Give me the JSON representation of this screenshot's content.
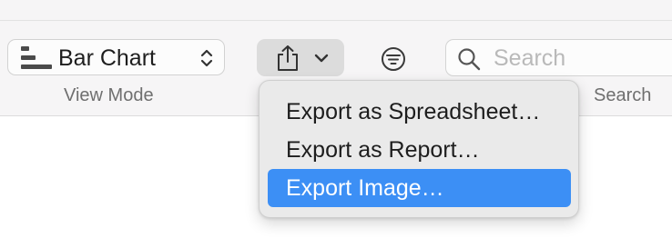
{
  "toolbar": {
    "view_mode": {
      "selected": "Bar Chart",
      "caption": "View Mode"
    },
    "export_button": {
      "icon": "share-icon"
    },
    "filter_button": {
      "icon": "filter-icon"
    },
    "search": {
      "placeholder": "Search",
      "caption": "Search"
    }
  },
  "export_menu": {
    "items": [
      {
        "label": "Export as Spreadsheet…",
        "selected": false
      },
      {
        "label": "Export as Report…",
        "selected": false
      },
      {
        "label": "Export Image…",
        "selected": true
      }
    ],
    "highlight_color": "#3c8ff5"
  }
}
